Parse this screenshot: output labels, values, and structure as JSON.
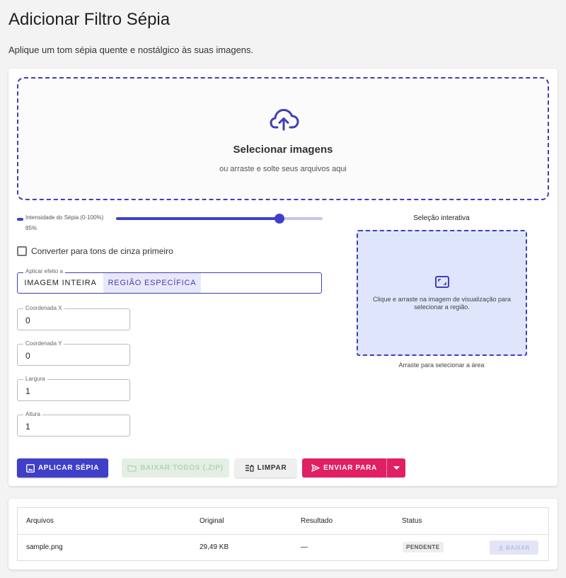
{
  "page": {
    "title": "Adicionar Filtro Sépia",
    "subtitle": "Aplique um tom sépia quente e nostálgico às suas imagens."
  },
  "dropzone": {
    "icon": "cloud-upload-icon",
    "title": "Selecionar imagens",
    "subtitle": "ou arraste e solte seus arquivos aqui"
  },
  "settings": {
    "intensity": {
      "label": "Intensidade do Sépia (0-100%)",
      "value_label": "85%",
      "value": 0.79
    },
    "grayscale_checkbox": {
      "label": "Converter para tons de cinza primeiro",
      "checked": false
    },
    "apply_to": {
      "legend": "Aplicar efeito a",
      "options": [
        "IMAGEM INTEIRA",
        "REGIÃO ESPECÍFICA"
      ],
      "selected": "REGIÃO ESPECÍFICA"
    },
    "fields": {
      "x": {
        "label": "Coordenada X",
        "value": "0"
      },
      "y": {
        "label": "Coordenada Y",
        "value": "0"
      },
      "width": {
        "label": "Largura",
        "value": "1"
      },
      "height": {
        "label": "Altura",
        "value": "1"
      }
    }
  },
  "selection": {
    "title": "Seleção interativa",
    "icon": "crop-frame-icon",
    "hint": "Clique e arraste na imagem de visualização para selecionar a região.",
    "caption": "Arraste para selecionar a área"
  },
  "actions": {
    "apply": "APLICAR SÉPIA",
    "download_all": "BAIXAR TODOS (.ZIP)",
    "clear": "LIMPAR",
    "send": "ENVIAR PARA"
  },
  "table": {
    "headers": {
      "files": "Arquivos",
      "original": "Original",
      "result": "Resultado",
      "status": "Status"
    },
    "rows": [
      {
        "file": "sample.png",
        "original": "29,49 KB",
        "result": "—",
        "status": "PENDENTE",
        "action": "BAIXAR"
      }
    ]
  },
  "colors": {
    "primary": "#3f3fc8",
    "accent": "#e11f63",
    "preview_bg": "#dfe6fb"
  }
}
